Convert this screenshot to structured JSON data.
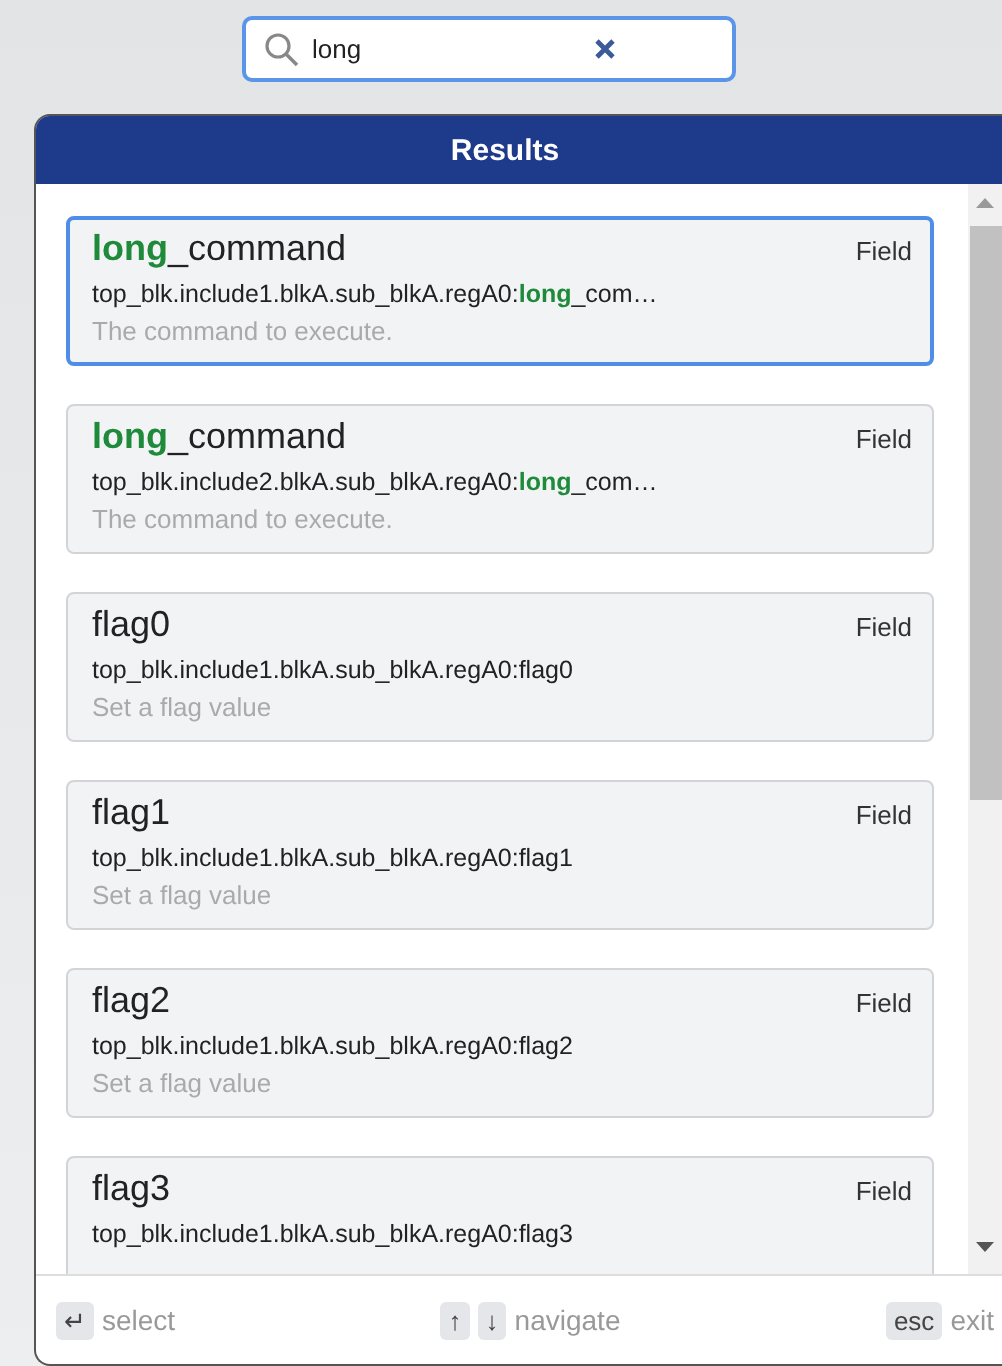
{
  "search": {
    "value": "long"
  },
  "panel": {
    "title": "Results"
  },
  "results": [
    {
      "title": "**long**_command",
      "type": "Field",
      "path": "top_blk.include1.blkA.sub_blkA.regA0:**long**_com…",
      "description": "The command to execute.",
      "selected": true
    },
    {
      "title": "**long**_command",
      "type": "Field",
      "path": "top_blk.include2.blkA.sub_blkA.regA0:**long**_com…",
      "description": "The command to execute.",
      "selected": false
    },
    {
      "title": "flag0",
      "type": "Field",
      "path": "top_blk.include1.blkA.sub_blkA.regA0:flag0",
      "description": "Set a flag value",
      "selected": false
    },
    {
      "title": "flag1",
      "type": "Field",
      "path": "top_blk.include1.blkA.sub_blkA.regA0:flag1",
      "description": "Set a flag value",
      "selected": false
    },
    {
      "title": "flag2",
      "type": "Field",
      "path": "top_blk.include1.blkA.sub_blkA.regA0:flag2",
      "description": "Set a flag value",
      "selected": false
    },
    {
      "title": "flag3",
      "type": "Field",
      "path": "top_blk.include1.blkA.sub_blkA.regA0:flag3",
      "selected": false
    }
  ],
  "footer": [
    {
      "keys": [
        "↵"
      ],
      "label": "select"
    },
    {
      "keys": [
        "↑",
        "↓"
      ],
      "label": "navigate"
    },
    {
      "keys": [
        "esc"
      ],
      "label": "exit"
    }
  ]
}
